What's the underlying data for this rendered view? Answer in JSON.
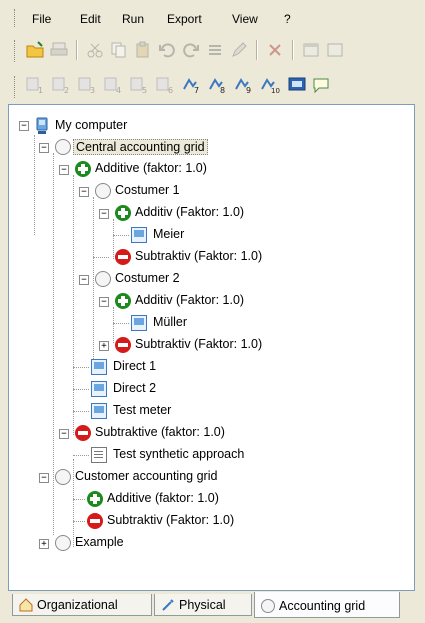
{
  "menu": {
    "items": [
      {
        "label": "File"
      },
      {
        "label": "Edit"
      },
      {
        "label": "Run"
      },
      {
        "label": "Export"
      },
      {
        "label": "View"
      },
      {
        "label": "?"
      }
    ]
  },
  "toolbar2": {
    "subscripts": [
      "1",
      "2",
      "3",
      "4",
      "5",
      "6",
      "7",
      "8",
      "9",
      "10"
    ]
  },
  "tree": {
    "my_computer": "My computer",
    "central_grid": "Central accounting grid",
    "additive_faktor": "Additive (faktor: 1.0)",
    "costumer1": "Costumer 1",
    "c1_additiv": "Additiv (Faktor: 1.0)",
    "c1_meier": "Meier",
    "c1_subtraktiv": "Subtraktiv (Faktor: 1.0)",
    "costumer2": "Costumer 2",
    "c2_additiv": "Additiv (Faktor: 1.0)",
    "c2_mueller": "Müller",
    "c2_subtraktiv": "Subtraktiv (Faktor: 1.0)",
    "direct1": "Direct 1",
    "direct2": "Direct 2",
    "test_meter": "Test meter",
    "subtraktive_faktor": "Subtraktive (faktor: 1.0)",
    "test_synthetic": "Test synthetic approach",
    "customer_grid": "Customer accounting grid",
    "cg_additive": "Additive (faktor: 1.0)",
    "cg_subtraktiv": "Subtraktiv (Faktor: 1.0)",
    "example": "Example"
  },
  "tabs": {
    "organizational": "Organizational",
    "physical": "Physical",
    "accounting_grid": "Accounting grid"
  },
  "colors": {
    "additive": "#1c8a1c",
    "subtractive": "#d61a1a",
    "meter": "#3a78c2",
    "window_bg": "#ece9d8"
  }
}
